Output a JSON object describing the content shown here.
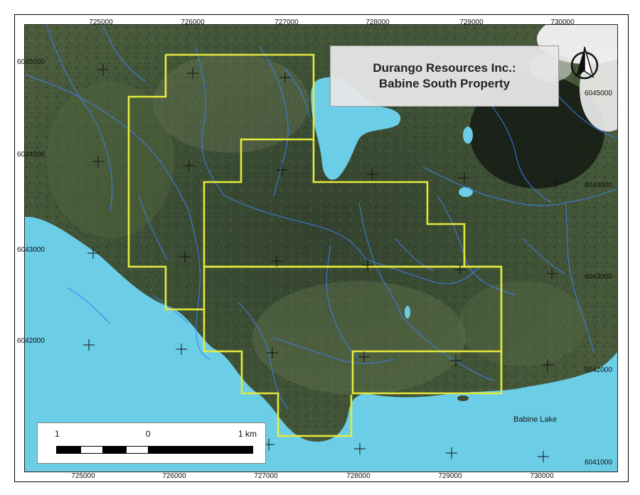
{
  "map": {
    "title_line1": "Durango Resources Inc.:",
    "title_line2": "Babine South Property",
    "lake_label": "Babine Lake",
    "north_arrow_icon": "north-arrow-icon",
    "scale": {
      "label_left": "1",
      "label_mid": "0",
      "label_right": "1 km"
    },
    "easting_ticks": [
      "725000",
      "726000",
      "727000",
      "728000",
      "729000",
      "730000"
    ],
    "northing_ticks_left": [
      "6045000",
      "6044000",
      "6043000",
      "6042000"
    ],
    "northing_ticks_right": [
      "6045000",
      "6044000",
      "6043000",
      "6042000",
      "6041000"
    ],
    "colors": {
      "water": "#6bcde6",
      "forest": "#3a4a33",
      "boundary": "#e5ea3c",
      "streams": "#3f7ff2",
      "grid_cross": "#111111"
    }
  }
}
